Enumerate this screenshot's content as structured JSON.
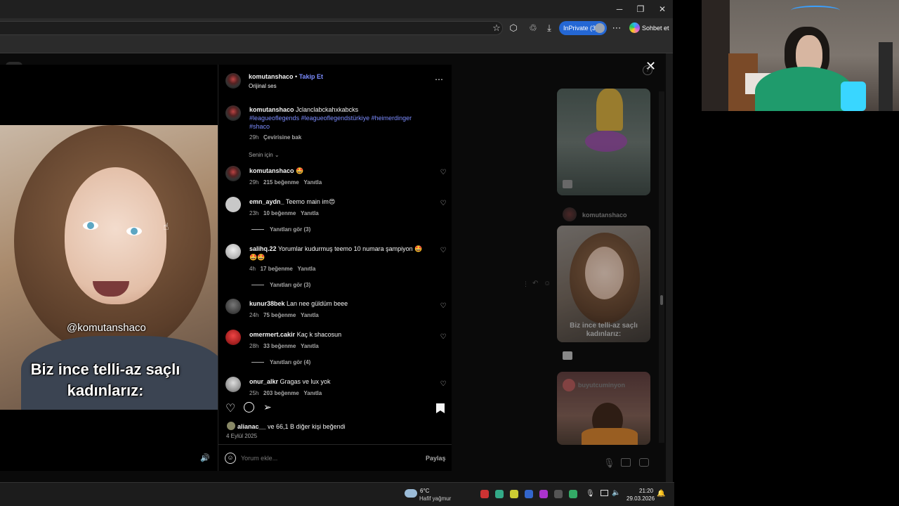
{
  "browser": {
    "inprivate_label": "InPrivate (3)",
    "copilot_label": "Sohbet et",
    "window_controls": [
      "minimize-icon",
      "restore-icon",
      "close-icon"
    ],
    "toolbar_icons": [
      "star-icon",
      "extensions-icon",
      "collections-icon",
      "download-icon",
      "more-icon"
    ]
  },
  "post": {
    "author": "komutanshaco",
    "follow_label": "Takip Et",
    "audio": "Orijinal ses",
    "caption_user": "komutanshaco",
    "caption_text": "Jclanclabckahxkabcks",
    "hashtags": "#leagueoflegends #leagueoflegendstürkiye #heimerdinger",
    "hashtags2": "#shaco",
    "caption_time": "29h",
    "translate": "Çevirisine bak",
    "sort_label": "Senin için",
    "likes_user": "alianac__",
    "likes_rest": " ve 66,1 B diğer kişi beğendi",
    "date": "4 Eylül 2025",
    "comment_placeholder": "Yorum ekle...",
    "share_label": "Paylaş"
  },
  "video": {
    "handle": "@komutanshaco",
    "caption_line1": "Biz ince telli-az saçlı",
    "caption_line2": "kadınlarız:"
  },
  "comments": [
    {
      "user": "komutanshaco",
      "text": "🤩",
      "time": "29h",
      "likes": "215 beğenme",
      "reply": "Yanıtla"
    },
    {
      "user": "emn_aydn_",
      "text": "Teemo main im😍",
      "time": "23h",
      "likes": "10 beğenme",
      "reply": "Yanıtla",
      "replies": "Yanıtları gör (3)"
    },
    {
      "user": "salihq.22",
      "text": "Yorumlar kudurmuş teemo 10 numara şampiyon 🤩",
      "text2": "🤩🤩",
      "time": "4h",
      "likes": "17 beğenme",
      "reply": "Yanıtla",
      "replies": "Yanıtları gör (3)"
    },
    {
      "user": "kunur38bek",
      "text": "Lan nee güldüm beee",
      "time": "24h",
      "likes": "75 beğenme",
      "reply": "Yanıtla"
    },
    {
      "user": "omermert.cakir",
      "text": "Kaç k shacosun",
      "time": "28h",
      "likes": "33 beğenme",
      "reply": "Yanıtla",
      "replies": "Yanıtları gör (4)"
    },
    {
      "user": "onur_alkr",
      "text": "Gragas ve lux yok",
      "time": "25h",
      "likes": "203 beğenme",
      "reply": "Yanıtla"
    }
  ],
  "sidebar": {
    "thumb_user": "komutanshaco",
    "thumb_caption1": "Biz ince telli-az saçlı",
    "thumb_caption2": "kadınlarız:",
    "thumb_user2": "buyutcuminyon"
  },
  "taskbar": {
    "weather_temp": "6°C",
    "weather_desc": "Hafif yağmur",
    "time": "21:20",
    "date": "29.03.2026"
  }
}
